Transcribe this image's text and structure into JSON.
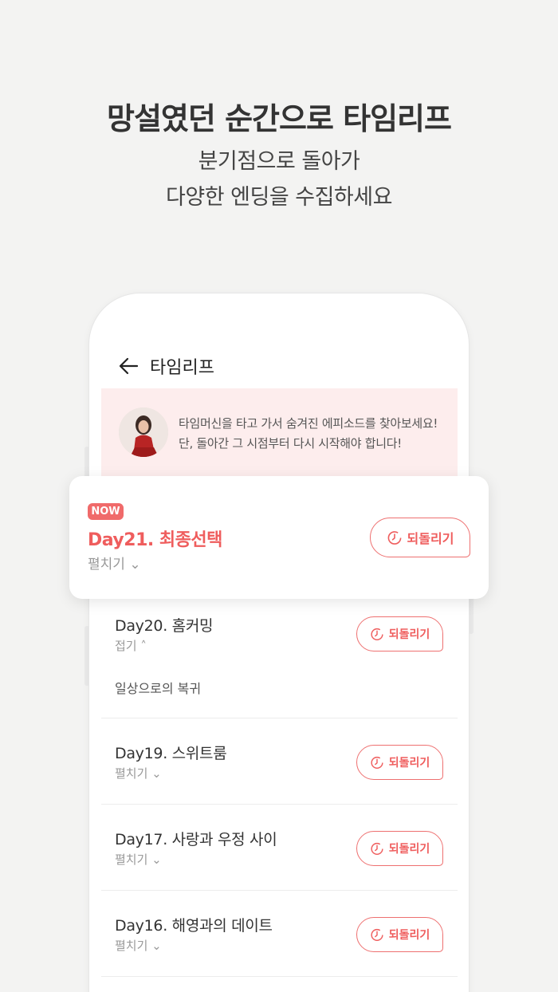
{
  "promo": {
    "title": "망설였던 순간으로 타임리프",
    "subtitle_line1": "분기점으로 돌아가",
    "subtitle_line2": "다양한 엔딩을 수집하세요"
  },
  "screen": {
    "title": "타임리프",
    "notice_line1": "타임머신을 타고 가서 숨겨진 에피소드를 찾아보세요!",
    "notice_line2": "단, 돌아간 그 시점부터 다시 시작해야 합니다!"
  },
  "current": {
    "badge": "NOW",
    "title": "Day21. 최종선택",
    "toggle": "펼치기",
    "rewind_label": "되돌리기"
  },
  "episodes": [
    {
      "title": "Day20. 홈커밍",
      "toggle": "접기",
      "expanded": true,
      "description": "일상으로의 복귀",
      "rewind_label": "되돌리기"
    },
    {
      "title": "Day19. 스위트룸",
      "toggle": "펼치기",
      "expanded": false,
      "rewind_label": "되돌리기"
    },
    {
      "title": "Day17. 사랑과 우정 사이",
      "toggle": "펼치기",
      "expanded": false,
      "rewind_label": "되돌리기"
    },
    {
      "title": "Day16. 해영과의 데이트",
      "toggle": "펼치기",
      "expanded": false,
      "rewind_label": "되돌리기"
    }
  ],
  "colors": {
    "accent": "#ef5d5d",
    "badge": "#f06a6a",
    "notice_bg": "#fdeded",
    "page_bg": "#f3f3f2"
  },
  "icons": [
    "back-arrow-icon",
    "timer-icon",
    "chevron-down-icon",
    "chevron-up-icon"
  ]
}
